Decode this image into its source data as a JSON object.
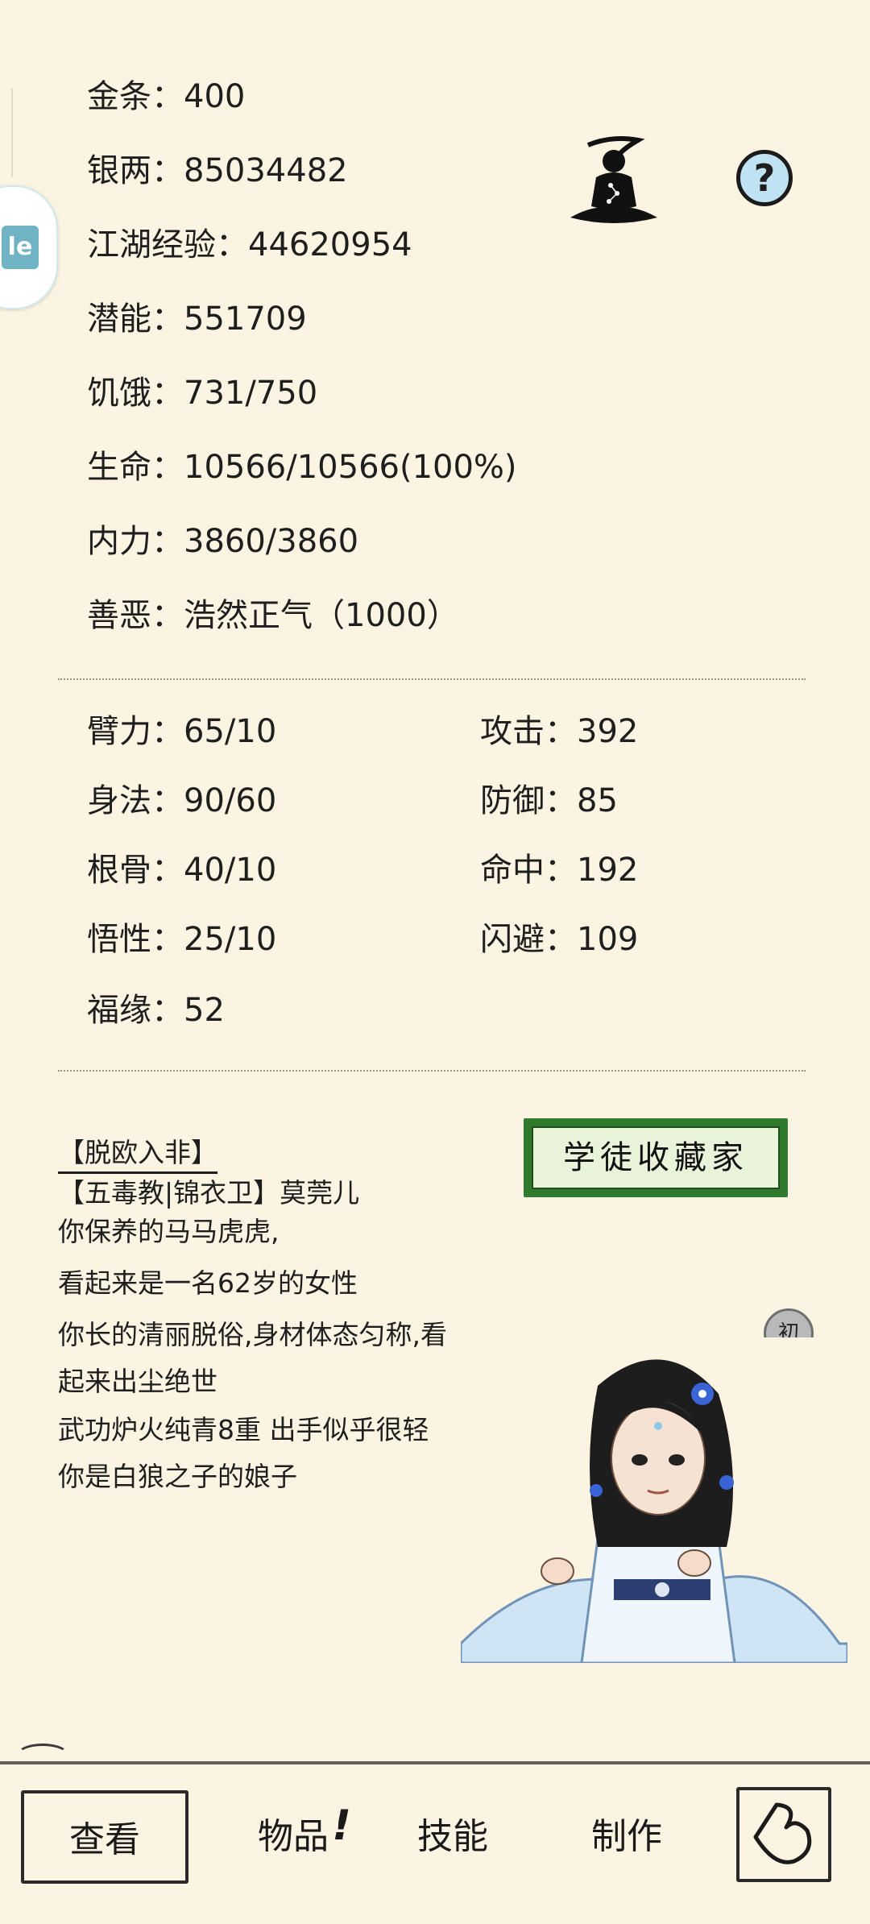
{
  "basic_stats": [
    {
      "label": "金条",
      "value": "400"
    },
    {
      "label": "银两",
      "value": "85034482"
    },
    {
      "label": "江湖经验",
      "value": "44620954"
    },
    {
      "label": "潜能",
      "value": "551709"
    },
    {
      "label": "饥饿",
      "value": "731/750"
    },
    {
      "label": "生命",
      "value": "10566/10566(100%)"
    },
    {
      "label": "内力",
      "value": "3860/3860"
    },
    {
      "label": "善恶",
      "value": "浩然正气（1000）"
    }
  ],
  "attributes_left": [
    {
      "label": "臂力",
      "value": "65/10"
    },
    {
      "label": "身法",
      "value": "90/60"
    },
    {
      "label": "根骨",
      "value": "40/10"
    },
    {
      "label": "悟性",
      "value": "25/10"
    },
    {
      "label": "福缘",
      "value": "52"
    }
  ],
  "attributes_right": [
    {
      "label": "攻击",
      "value": "392"
    },
    {
      "label": "防御",
      "value": "85"
    },
    {
      "label": "命中",
      "value": "192"
    },
    {
      "label": "闪避",
      "value": "109"
    }
  ],
  "help_icon_text": "?",
  "title_banner": "学徒收藏家",
  "badge_text": "初",
  "character": {
    "nickname": "【脱欧入非】",
    "faction_name": "【五毒教|锦衣卫】莫莞儿",
    "description_lines": [
      "你保养的马马虎虎,",
      "看起来是一名62岁的女性",
      "你长的清丽脱俗,身材体态匀称,看",
      "起来出尘绝世",
      "武功炉火纯青8重 出手似乎很轻",
      "你是白狼之子的娘子"
    ]
  },
  "side_float_text": "le",
  "bottom_nav": {
    "items": [
      {
        "label": "查看",
        "selected": true
      },
      {
        "label": "物品",
        "badge": "!"
      },
      {
        "label": "技能"
      },
      {
        "label": "制作"
      }
    ],
    "back_icon": "back-arrow-icon"
  },
  "colors": {
    "background": "#fbf4e2",
    "banner_green": "#2f7a2c",
    "help_blue": "#bfe3f2"
  }
}
